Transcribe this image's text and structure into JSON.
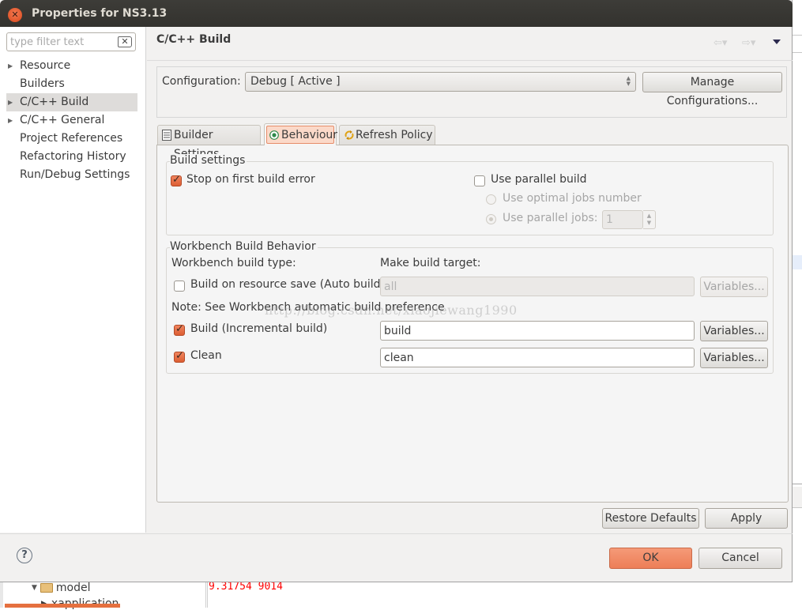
{
  "window": {
    "title": "Properties for NS3.13"
  },
  "sidebar": {
    "filter_placeholder": "type filter text",
    "filter_value": "",
    "items": [
      {
        "label": "Resource",
        "expandable": true,
        "selected": false
      },
      {
        "label": "Builders",
        "expandable": false,
        "selected": false
      },
      {
        "label": "C/C++ Build",
        "expandable": true,
        "selected": true
      },
      {
        "label": "C/C++ General",
        "expandable": true,
        "selected": false
      },
      {
        "label": "Project References",
        "expandable": false,
        "selected": false
      },
      {
        "label": "Refactoring History",
        "expandable": false,
        "selected": false
      },
      {
        "label": "Run/Debug Settings",
        "expandable": false,
        "selected": false
      }
    ]
  },
  "header": {
    "page_title": "C/C++ Build",
    "back_icon": "arrow-left-icon",
    "forward_icon": "arrow-right-icon",
    "back_glyph": "⇦▾",
    "forward_glyph": "⇨▾"
  },
  "configuration": {
    "label": "Configuration:",
    "selected": "Debug  [ Active ]",
    "manage_button": "Manage Configurations..."
  },
  "tabs": [
    {
      "label": "Builder Settings",
      "icon": "list-icon",
      "active": false
    },
    {
      "label": "Behaviour",
      "icon": "target-icon",
      "active": true
    },
    {
      "label": "Refresh Policy",
      "icon": "refresh-icon",
      "active": false
    }
  ],
  "build_settings": {
    "title": "Build settings",
    "stop_on_first_error": {
      "label": "Stop on first build error",
      "checked": true
    },
    "use_parallel_build": {
      "label": "Use parallel build",
      "checked": false
    },
    "use_optimal_jobs": {
      "label": "Use optimal jobs number",
      "selected": false,
      "enabled": false
    },
    "use_parallel_jobs": {
      "label": "Use parallel jobs:",
      "selected": true,
      "enabled": false,
      "value": "1"
    }
  },
  "workbench": {
    "title": "Workbench Build Behavior",
    "type_header": "Workbench build type:",
    "target_header": "Make build target:",
    "note": "Note: See Workbench automatic build preference",
    "rows": [
      {
        "label": "Build on resource save (Auto build)",
        "checked": false,
        "target": "all",
        "enabled": false,
        "variables_label": "Variables..."
      },
      {
        "label": "Build (Incremental build)",
        "checked": true,
        "target": "build",
        "enabled": true,
        "variables_label": "Variables..."
      },
      {
        "label": "Clean",
        "checked": true,
        "target": "clean",
        "enabled": true,
        "variables_label": "Variables..."
      }
    ]
  },
  "watermark": "http://blog.csdn.net/xiaojiewang1990",
  "footer": {
    "restore_defaults": "Restore Defaults",
    "apply": "Apply",
    "ok": "OK",
    "cancel": "Cancel",
    "help_glyph": "?"
  },
  "background": {
    "tree_item_model": "model",
    "tree_item_partial": "xapplication",
    "console_text": "9.31754 9014"
  },
  "colors": {
    "accent_orange": "#ed7e57",
    "checkbox_orange": "#dc5e33",
    "titlebar": "#3d3c38",
    "console_red": "#ff0000"
  }
}
